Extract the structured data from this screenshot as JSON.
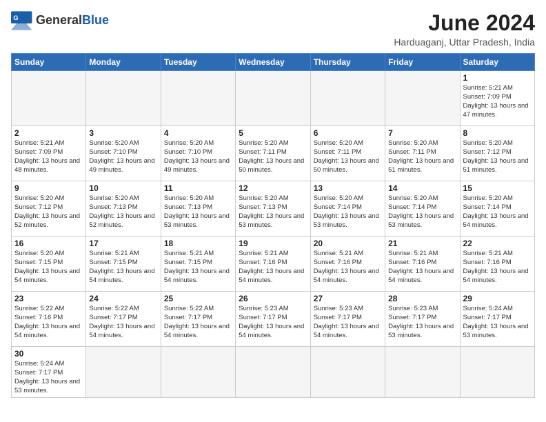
{
  "header": {
    "logo_general": "General",
    "logo_blue": "Blue",
    "month_title": "June 2024",
    "location": "Harduaganj, Uttar Pradesh, India"
  },
  "weekdays": [
    "Sunday",
    "Monday",
    "Tuesday",
    "Wednesday",
    "Thursday",
    "Friday",
    "Saturday"
  ],
  "days": [
    {
      "num": "",
      "sunrise": "",
      "sunset": "",
      "daylight": ""
    },
    {
      "num": "",
      "sunrise": "",
      "sunset": "",
      "daylight": ""
    },
    {
      "num": "",
      "sunrise": "",
      "sunset": "",
      "daylight": ""
    },
    {
      "num": "",
      "sunrise": "",
      "sunset": "",
      "daylight": ""
    },
    {
      "num": "",
      "sunrise": "",
      "sunset": "",
      "daylight": ""
    },
    {
      "num": "",
      "sunrise": "",
      "sunset": "",
      "daylight": ""
    },
    {
      "num": "1",
      "sunrise": "Sunrise: 5:21 AM",
      "sunset": "Sunset: 7:09 PM",
      "daylight": "Daylight: 13 hours and 47 minutes."
    },
    {
      "num": "2",
      "sunrise": "Sunrise: 5:21 AM",
      "sunset": "Sunset: 7:09 PM",
      "daylight": "Daylight: 13 hours and 48 minutes."
    },
    {
      "num": "3",
      "sunrise": "Sunrise: 5:20 AM",
      "sunset": "Sunset: 7:10 PM",
      "daylight": "Daylight: 13 hours and 49 minutes."
    },
    {
      "num": "4",
      "sunrise": "Sunrise: 5:20 AM",
      "sunset": "Sunset: 7:10 PM",
      "daylight": "Daylight: 13 hours and 49 minutes."
    },
    {
      "num": "5",
      "sunrise": "Sunrise: 5:20 AM",
      "sunset": "Sunset: 7:11 PM",
      "daylight": "Daylight: 13 hours and 50 minutes."
    },
    {
      "num": "6",
      "sunrise": "Sunrise: 5:20 AM",
      "sunset": "Sunset: 7:11 PM",
      "daylight": "Daylight: 13 hours and 50 minutes."
    },
    {
      "num": "7",
      "sunrise": "Sunrise: 5:20 AM",
      "sunset": "Sunset: 7:11 PM",
      "daylight": "Daylight: 13 hours and 51 minutes."
    },
    {
      "num": "8",
      "sunrise": "Sunrise: 5:20 AM",
      "sunset": "Sunset: 7:12 PM",
      "daylight": "Daylight: 13 hours and 51 minutes."
    },
    {
      "num": "9",
      "sunrise": "Sunrise: 5:20 AM",
      "sunset": "Sunset: 7:12 PM",
      "daylight": "Daylight: 13 hours and 52 minutes."
    },
    {
      "num": "10",
      "sunrise": "Sunrise: 5:20 AM",
      "sunset": "Sunset: 7:13 PM",
      "daylight": "Daylight: 13 hours and 52 minutes."
    },
    {
      "num": "11",
      "sunrise": "Sunrise: 5:20 AM",
      "sunset": "Sunset: 7:13 PM",
      "daylight": "Daylight: 13 hours and 53 minutes."
    },
    {
      "num": "12",
      "sunrise": "Sunrise: 5:20 AM",
      "sunset": "Sunset: 7:13 PM",
      "daylight": "Daylight: 13 hours and 53 minutes."
    },
    {
      "num": "13",
      "sunrise": "Sunrise: 5:20 AM",
      "sunset": "Sunset: 7:14 PM",
      "daylight": "Daylight: 13 hours and 53 minutes."
    },
    {
      "num": "14",
      "sunrise": "Sunrise: 5:20 AM",
      "sunset": "Sunset: 7:14 PM",
      "daylight": "Daylight: 13 hours and 53 minutes."
    },
    {
      "num": "15",
      "sunrise": "Sunrise: 5:20 AM",
      "sunset": "Sunset: 7:14 PM",
      "daylight": "Daylight: 13 hours and 54 minutes."
    },
    {
      "num": "16",
      "sunrise": "Sunrise: 5:20 AM",
      "sunset": "Sunset: 7:15 PM",
      "daylight": "Daylight: 13 hours and 54 minutes."
    },
    {
      "num": "17",
      "sunrise": "Sunrise: 5:21 AM",
      "sunset": "Sunset: 7:15 PM",
      "daylight": "Daylight: 13 hours and 54 minutes."
    },
    {
      "num": "18",
      "sunrise": "Sunrise: 5:21 AM",
      "sunset": "Sunset: 7:15 PM",
      "daylight": "Daylight: 13 hours and 54 minutes."
    },
    {
      "num": "19",
      "sunrise": "Sunrise: 5:21 AM",
      "sunset": "Sunset: 7:16 PM",
      "daylight": "Daylight: 13 hours and 54 minutes."
    },
    {
      "num": "20",
      "sunrise": "Sunrise: 5:21 AM",
      "sunset": "Sunset: 7:16 PM",
      "daylight": "Daylight: 13 hours and 54 minutes."
    },
    {
      "num": "21",
      "sunrise": "Sunrise: 5:21 AM",
      "sunset": "Sunset: 7:16 PM",
      "daylight": "Daylight: 13 hours and 54 minutes."
    },
    {
      "num": "22",
      "sunrise": "Sunrise: 5:21 AM",
      "sunset": "Sunset: 7:16 PM",
      "daylight": "Daylight: 13 hours and 54 minutes."
    },
    {
      "num": "23",
      "sunrise": "Sunrise: 5:22 AM",
      "sunset": "Sunset: 7:16 PM",
      "daylight": "Daylight: 13 hours and 54 minutes."
    },
    {
      "num": "24",
      "sunrise": "Sunrise: 5:22 AM",
      "sunset": "Sunset: 7:17 PM",
      "daylight": "Daylight: 13 hours and 54 minutes."
    },
    {
      "num": "25",
      "sunrise": "Sunrise: 5:22 AM",
      "sunset": "Sunset: 7:17 PM",
      "daylight": "Daylight: 13 hours and 54 minutes."
    },
    {
      "num": "26",
      "sunrise": "Sunrise: 5:23 AM",
      "sunset": "Sunset: 7:17 PM",
      "daylight": "Daylight: 13 hours and 54 minutes."
    },
    {
      "num": "27",
      "sunrise": "Sunrise: 5:23 AM",
      "sunset": "Sunset: 7:17 PM",
      "daylight": "Daylight: 13 hours and 54 minutes."
    },
    {
      "num": "28",
      "sunrise": "Sunrise: 5:23 AM",
      "sunset": "Sunset: 7:17 PM",
      "daylight": "Daylight: 13 hours and 53 minutes."
    },
    {
      "num": "29",
      "sunrise": "Sunrise: 5:24 AM",
      "sunset": "Sunset: 7:17 PM",
      "daylight": "Daylight: 13 hours and 53 minutes."
    },
    {
      "num": "30",
      "sunrise": "Sunrise: 5:24 AM",
      "sunset": "Sunset: 7:17 PM",
      "daylight": "Daylight: 13 hours and 53 minutes."
    },
    {
      "num": "",
      "sunrise": "",
      "sunset": "",
      "daylight": ""
    },
    {
      "num": "",
      "sunrise": "",
      "sunset": "",
      "daylight": ""
    },
    {
      "num": "",
      "sunrise": "",
      "sunset": "",
      "daylight": ""
    },
    {
      "num": "",
      "sunrise": "",
      "sunset": "",
      "daylight": ""
    },
    {
      "num": "",
      "sunrise": "",
      "sunset": "",
      "daylight": ""
    },
    {
      "num": "",
      "sunrise": "",
      "sunset": "",
      "daylight": ""
    }
  ]
}
